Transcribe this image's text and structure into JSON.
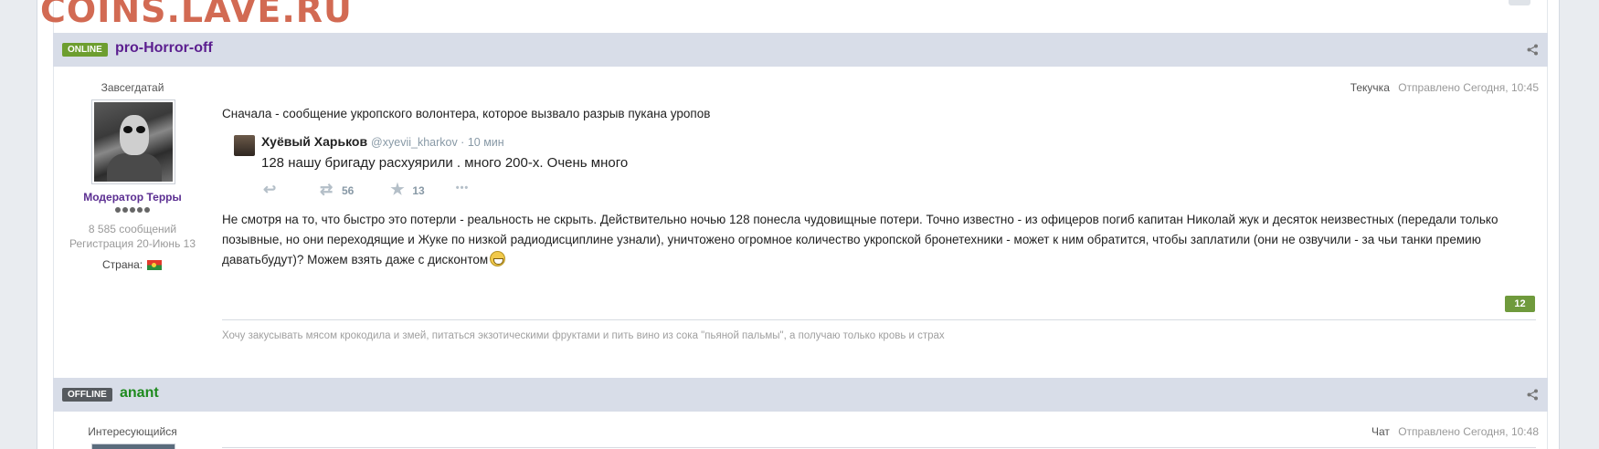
{
  "watermark": "COINS.LAVE.RU",
  "posts": [
    {
      "status": "ONLINE",
      "author": "pro-Horror-off",
      "author_color": "#5b1e8f",
      "rank": "Завсегдатай",
      "group": "Модератор Терры",
      "post_count": "8 585 сообщений",
      "registration": "Регистрация 20-Июнь 13",
      "country_label": "Страна:",
      "category": "Текучка",
      "posted": "Отправлено Сегодня, 10:45",
      "intro": "Сначала - сообщение укропского волонтера, которое вызвало разрыв пукана уропов",
      "tweet": {
        "name": "Хуёвый Харьков",
        "handle": "@xyevii_kharkov · 10 мин",
        "text": "128 нашу бригаду расхуярили . много 200-х. Очень много",
        "retweets": "56",
        "favorites": "13"
      },
      "body": "Не смотря на то, что быстро это потерли - реальность не скрыть. Действительно ночью 128 понесла чудовищные потери. Точно известно - из офицеров погиб капитан Николай жук и десяток неизвестных  (передали только позывные, но они переходящие и Жуке по низкой радиодисциплине узнали), уничтожено огромное количество укропской бронетехники - может к ним обратится, чтобы заплатили (они не озвучили - за чьи танки премию даватьбудут)? Можем взять даже с дисконтом",
      "reputation": "12",
      "signature": "Хочу закусывать мясом крокодила и змей, питаться экзотическими фруктами и пить вино из сока \"пьяной пальмы\", а получаю только кровь и страх"
    },
    {
      "status": "OFFLINE",
      "author": "anant",
      "author_color": "#1e8a1e",
      "rank": "Интересующийся",
      "category": "Чат",
      "posted": "Отправлено Сегодня, 10:48"
    }
  ],
  "colors": {
    "header_bg": "#d8dde8",
    "online": "#6d9e2f",
    "offline": "#565a5f",
    "reputation": "#6f9a3c"
  }
}
